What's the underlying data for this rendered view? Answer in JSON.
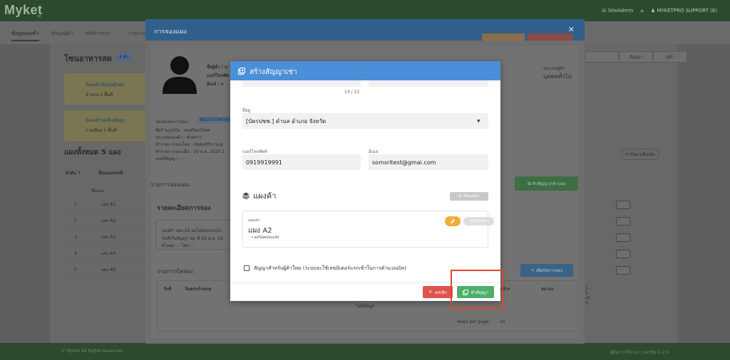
{
  "app": {
    "logo": "Myket",
    "logo_sub": "sp",
    "topbar_right": [
      "⛁ SiteAdmin",
      "⌂",
      "♟ MYKETPRO SUPPORT (E)"
    ]
  },
  "subnav": {
    "tabs": [
      "ข้อมูลแผงค้า",
      "ข้อมูลผู้ค้า",
      "สถิติการเช่า",
      "รายงาน"
    ]
  },
  "background": {
    "title": "โซนอาหารสด",
    "badge": "4 ค้า",
    "notice1_title": "มีแผงค้าใหม่รอยืนยัน",
    "notice1_text": "จำนวน 1 พื้นที่",
    "notice2_title": "มีแผงค้ารอเซ็นสัญญา",
    "notice2_text": "รายเดือน 1 พื้นที่",
    "all_stalls": "แผงทั้งหมด 5 แผง",
    "col_no": "ลำดับ ↑",
    "col_name": "ชื่อแผง/เลขที่",
    "filter_placeholder": "ชื่อแผง",
    "rows": [
      {
        "no": "1",
        "name": "แผง A1"
      },
      {
        "no": "2",
        "name": "แผง A2"
      },
      {
        "no": "3",
        "name": "แผง A3"
      },
      {
        "no": "4",
        "name": "แผง A4"
      },
      {
        "no": "5",
        "name": "แผง A5"
      }
    ],
    "right_tabs": [
      "",
      "สัญญา",
      "ผู้ค้า"
    ],
    "extra_btn": "⟲ ค้นหาเพิ่มเติม",
    "footer_left": "© Myket All Rights Reserved",
    "footer_right": "คู่มือการใช้งาน | เวอร์ชัน 1.2.0"
  },
  "outer_modal": {
    "title": "การจองแผง",
    "close": "✕",
    "name_label": "ชื่อผู้ค้า / บ",
    "phone_label": "เบอร์โทรศัพ",
    "email_label": "อีเมล์ : s",
    "customer_type_label": "ประเภทผู้ค้า",
    "customer_type": "บุคคลทั่วไป",
    "booking_no_label": "หมายเลขการจอง :",
    "booking_no": "BK202508000",
    "line2": "ชื่อร้าน/ธุรกิจ : สมศรีผลไม้สด",
    "line3": "ประเภทแผงค้า : ชั่วคราว",
    "line4": "ทำรายการจองโดย : MyketPro Sup",
    "line5": "ทำรายการจองเมื่อ : 20 ส.ค. 2025 1",
    "line6": "เลขที่สัญญา : -",
    "stall_list_title": "รายการจองแผง",
    "detail_title": "รายละเอียดการจอง",
    "detail_line1": "แผงค้า แผง A2  ผลไม้สด/อบแห้ง",
    "detail_line2": "วันที่เริ่มสัญญา พุธ ที่ 20 ส.ค. 20",
    "detail_line3": "ผ้าแผง : - โดย : -",
    "make_contract_btn": "⊞ ทำสัญญา/เช่าแผง",
    "bills_title": "รายการบิลจอง",
    "add_bill_btn": "+ เพิ่มบิลการจอง",
    "col_date": "วันที่",
    "col_due": "วันครบกำหนด",
    "col_paid": "ค่าแผงค้าง",
    "col_status": "สถานะ",
    "no_data": "ไม่มีข้อมูล",
    "rows_per_page_label": "Rows per page:",
    "rows_per_page": "10",
    "pagination": "1-5 of 5"
  },
  "inner_modal": {
    "title": "สร้างสัญญาเช่า",
    "counter": "13 / 13",
    "address_label": "ที่อยู่",
    "address_value": "[บัตรปชช.] ตำบล อำเภอ จังหวัด",
    "phone_label": "เบอร์โทรศัพท์",
    "phone_value": "0919919991",
    "email_label": "อีเมล",
    "email_value": "somsritest@gmai.com",
    "section_title": "แผงค้า",
    "add_stall_btn": "เพิ่มแผงค้า",
    "stall_label": "แผงเช่า",
    "stall_name": "แผง A2",
    "stall_item": "ผลไม้สด/อบแห้ง",
    "cancel_stall_btn": "ยกเลิกแผง",
    "checkbox_label": "สัญญาสำหรับผู้ค้าใหม่ (ระบบจะใช้เลขมิเตอร์แรกเข้าในการคำนวณบิล)",
    "cancel_btn": "ยกเลิก",
    "make_btn": "ทำสัญญา"
  },
  "colors": {
    "inner_header": "#4a90d9",
    "cancel": "#e0544f",
    "confirm": "#4caf6a",
    "edit": "#f0ad3c",
    "highlight": "#e0452f"
  }
}
